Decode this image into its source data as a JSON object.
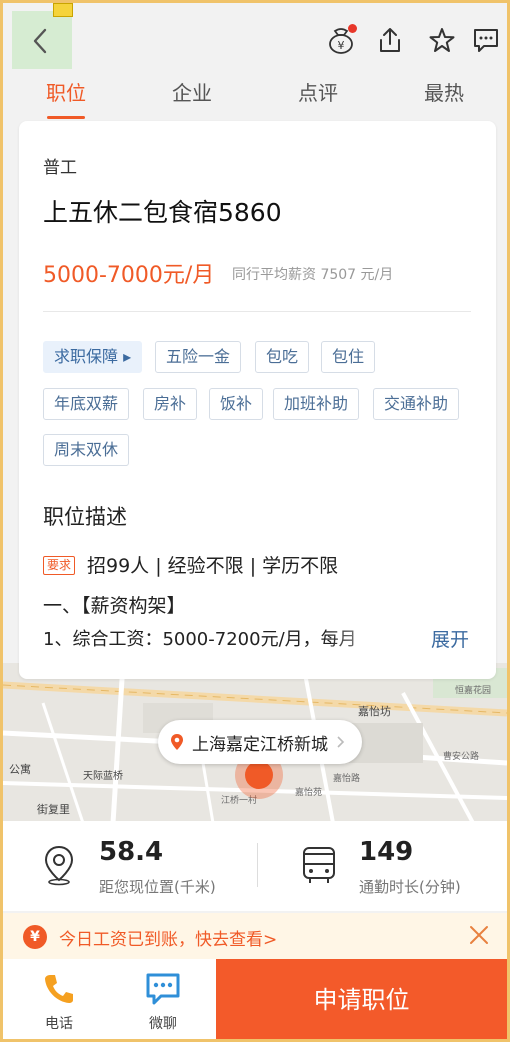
{
  "tabs": [
    "职位",
    "企业",
    "点评",
    "最热"
  ],
  "job": {
    "category": "普工",
    "title": "上五休二包食宿5860",
    "salary": "5000-7000元/月",
    "avg_salary": "同行平均薪资 7507 元/月"
  },
  "tags": {
    "guarantee": "求职保障 ▸",
    "items": [
      "五险一金",
      "包吃",
      "包住",
      "年底双薪",
      "房补",
      "饭补",
      "加班补助",
      "交通补助",
      "周末双休"
    ]
  },
  "description": {
    "heading": "职位描述",
    "req_badge": "要求",
    "requirements": "招99人 | 经验不限 | 学历不限",
    "line1": "一、【薪资构架】",
    "line2": "1、综合工资：5000-7200元/月，每月",
    "expand": "展开"
  },
  "map": {
    "location": "上海嘉定江桥新城",
    "labels": [
      "嘉怡坊",
      "天际蓝桥",
      "江桥一村",
      "嘉怡苑",
      "恒嘉花园",
      "公寓",
      "街复里",
      "曹安公路",
      "嘉怡路"
    ]
  },
  "stats": {
    "distance_value": "58.4",
    "distance_label": "距您现位置(千米)",
    "commute_value": "149",
    "commute_label": "通勤时长(分钟)"
  },
  "notice": {
    "text": "今日工资已到账，快去查看>"
  },
  "bottom": {
    "phone_label": "电话",
    "chat_label": "微聊",
    "apply_label": "申请职位"
  },
  "colors": {
    "accent": "#f05a27",
    "link": "#3b6aa0"
  }
}
